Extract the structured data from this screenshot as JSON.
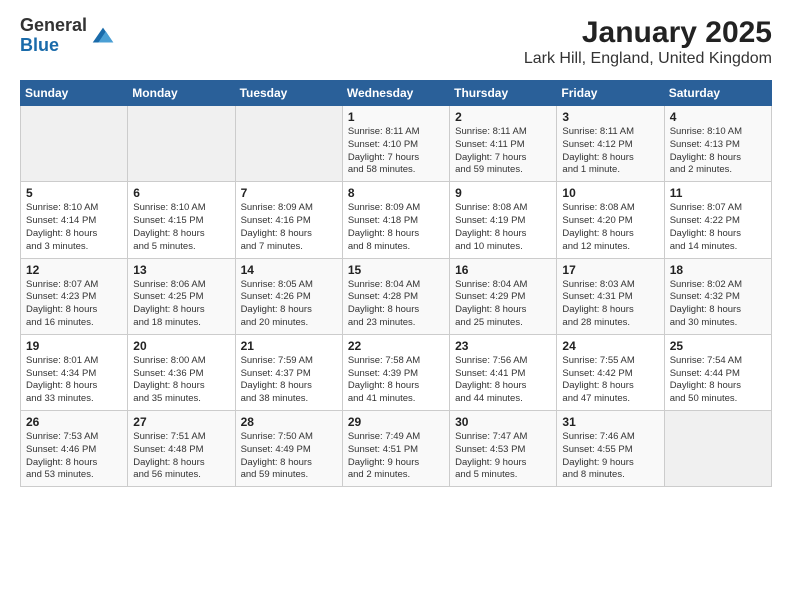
{
  "header": {
    "logo_line1": "General",
    "logo_line2": "Blue",
    "title": "January 2025",
    "subtitle": "Lark Hill, England, United Kingdom"
  },
  "weekdays": [
    "Sunday",
    "Monday",
    "Tuesday",
    "Wednesday",
    "Thursday",
    "Friday",
    "Saturday"
  ],
  "weeks": [
    [
      {
        "day": "",
        "info": ""
      },
      {
        "day": "",
        "info": ""
      },
      {
        "day": "",
        "info": ""
      },
      {
        "day": "1",
        "info": "Sunrise: 8:11 AM\nSunset: 4:10 PM\nDaylight: 7 hours\nand 58 minutes."
      },
      {
        "day": "2",
        "info": "Sunrise: 8:11 AM\nSunset: 4:11 PM\nDaylight: 7 hours\nand 59 minutes."
      },
      {
        "day": "3",
        "info": "Sunrise: 8:11 AM\nSunset: 4:12 PM\nDaylight: 8 hours\nand 1 minute."
      },
      {
        "day": "4",
        "info": "Sunrise: 8:10 AM\nSunset: 4:13 PM\nDaylight: 8 hours\nand 2 minutes."
      }
    ],
    [
      {
        "day": "5",
        "info": "Sunrise: 8:10 AM\nSunset: 4:14 PM\nDaylight: 8 hours\nand 3 minutes."
      },
      {
        "day": "6",
        "info": "Sunrise: 8:10 AM\nSunset: 4:15 PM\nDaylight: 8 hours\nand 5 minutes."
      },
      {
        "day": "7",
        "info": "Sunrise: 8:09 AM\nSunset: 4:16 PM\nDaylight: 8 hours\nand 7 minutes."
      },
      {
        "day": "8",
        "info": "Sunrise: 8:09 AM\nSunset: 4:18 PM\nDaylight: 8 hours\nand 8 minutes."
      },
      {
        "day": "9",
        "info": "Sunrise: 8:08 AM\nSunset: 4:19 PM\nDaylight: 8 hours\nand 10 minutes."
      },
      {
        "day": "10",
        "info": "Sunrise: 8:08 AM\nSunset: 4:20 PM\nDaylight: 8 hours\nand 12 minutes."
      },
      {
        "day": "11",
        "info": "Sunrise: 8:07 AM\nSunset: 4:22 PM\nDaylight: 8 hours\nand 14 minutes."
      }
    ],
    [
      {
        "day": "12",
        "info": "Sunrise: 8:07 AM\nSunset: 4:23 PM\nDaylight: 8 hours\nand 16 minutes."
      },
      {
        "day": "13",
        "info": "Sunrise: 8:06 AM\nSunset: 4:25 PM\nDaylight: 8 hours\nand 18 minutes."
      },
      {
        "day": "14",
        "info": "Sunrise: 8:05 AM\nSunset: 4:26 PM\nDaylight: 8 hours\nand 20 minutes."
      },
      {
        "day": "15",
        "info": "Sunrise: 8:04 AM\nSunset: 4:28 PM\nDaylight: 8 hours\nand 23 minutes."
      },
      {
        "day": "16",
        "info": "Sunrise: 8:04 AM\nSunset: 4:29 PM\nDaylight: 8 hours\nand 25 minutes."
      },
      {
        "day": "17",
        "info": "Sunrise: 8:03 AM\nSunset: 4:31 PM\nDaylight: 8 hours\nand 28 minutes."
      },
      {
        "day": "18",
        "info": "Sunrise: 8:02 AM\nSunset: 4:32 PM\nDaylight: 8 hours\nand 30 minutes."
      }
    ],
    [
      {
        "day": "19",
        "info": "Sunrise: 8:01 AM\nSunset: 4:34 PM\nDaylight: 8 hours\nand 33 minutes."
      },
      {
        "day": "20",
        "info": "Sunrise: 8:00 AM\nSunset: 4:36 PM\nDaylight: 8 hours\nand 35 minutes."
      },
      {
        "day": "21",
        "info": "Sunrise: 7:59 AM\nSunset: 4:37 PM\nDaylight: 8 hours\nand 38 minutes."
      },
      {
        "day": "22",
        "info": "Sunrise: 7:58 AM\nSunset: 4:39 PM\nDaylight: 8 hours\nand 41 minutes."
      },
      {
        "day": "23",
        "info": "Sunrise: 7:56 AM\nSunset: 4:41 PM\nDaylight: 8 hours\nand 44 minutes."
      },
      {
        "day": "24",
        "info": "Sunrise: 7:55 AM\nSunset: 4:42 PM\nDaylight: 8 hours\nand 47 minutes."
      },
      {
        "day": "25",
        "info": "Sunrise: 7:54 AM\nSunset: 4:44 PM\nDaylight: 8 hours\nand 50 minutes."
      }
    ],
    [
      {
        "day": "26",
        "info": "Sunrise: 7:53 AM\nSunset: 4:46 PM\nDaylight: 8 hours\nand 53 minutes."
      },
      {
        "day": "27",
        "info": "Sunrise: 7:51 AM\nSunset: 4:48 PM\nDaylight: 8 hours\nand 56 minutes."
      },
      {
        "day": "28",
        "info": "Sunrise: 7:50 AM\nSunset: 4:49 PM\nDaylight: 8 hours\nand 59 minutes."
      },
      {
        "day": "29",
        "info": "Sunrise: 7:49 AM\nSunset: 4:51 PM\nDaylight: 9 hours\nand 2 minutes."
      },
      {
        "day": "30",
        "info": "Sunrise: 7:47 AM\nSunset: 4:53 PM\nDaylight: 9 hours\nand 5 minutes."
      },
      {
        "day": "31",
        "info": "Sunrise: 7:46 AM\nSunset: 4:55 PM\nDaylight: 9 hours\nand 8 minutes."
      },
      {
        "day": "",
        "info": ""
      }
    ]
  ]
}
